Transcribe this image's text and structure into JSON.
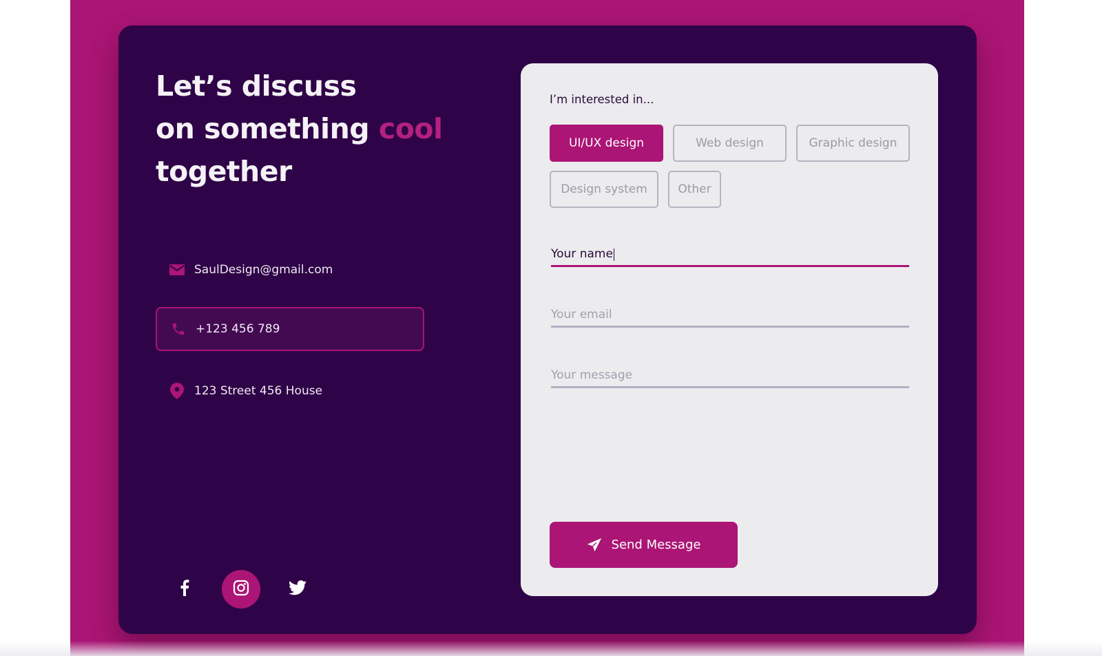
{
  "headline": {
    "line1": "Let’s discuss",
    "line2_start": "on something ",
    "line2_accent": "cool",
    "line3": "together"
  },
  "contacts": {
    "email": "SaulDesign@gmail.com",
    "phone": "+123 456 789",
    "address": "123 Street 456 House"
  },
  "socials": [
    {
      "name": "facebook-icon",
      "active": false
    },
    {
      "name": "instagram-icon",
      "active": true
    },
    {
      "name": "twitter-icon",
      "active": false
    }
  ],
  "form": {
    "interest_label": "I’m interested in...",
    "chips": [
      "UI/UX design",
      "Web design",
      "Graphic design",
      "Design system",
      "Other"
    ],
    "selected_chip": "UI/UX design",
    "name_value": "Your name",
    "email_placeholder": "Your email",
    "message_placeholder": "Your message",
    "send_label": "Send Message"
  },
  "colors": {
    "background": "#ab1575",
    "card": "#2f0347",
    "accent": "#ab1575",
    "form_bg": "#ececee"
  }
}
